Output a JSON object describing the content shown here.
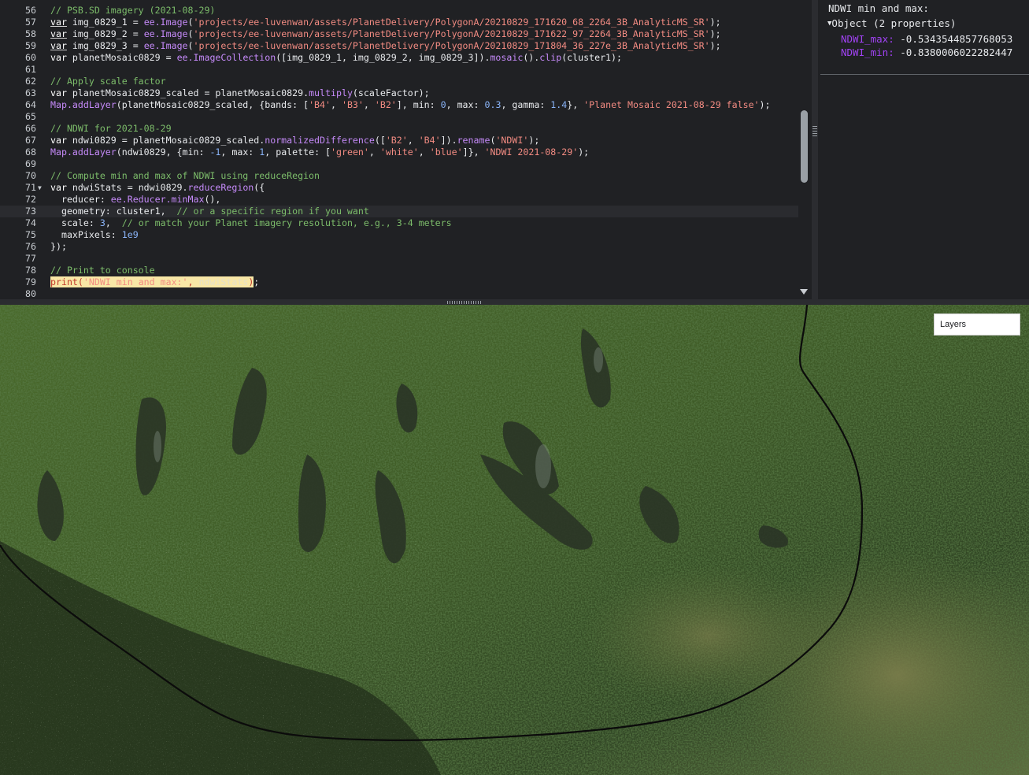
{
  "editor": {
    "lines": [
      {
        "n": "56",
        "html": "<span class=\"cm\">// PSB.SD imagery (2021-08-29)</span>"
      },
      {
        "n": "57",
        "html": "<span class=\"kw\">var</span> img_0829_1 = <span class=\"fn\">ee.Image</span>(<span class=\"str\">'projects/ee-luvenwan/assets/PlanetDelivery/PolygonA/20210829_171620_68_2264_3B_AnalyticMS_SR'</span>);"
      },
      {
        "n": "58",
        "html": "<span class=\"kw\">var</span> img_0829_2 = <span class=\"fn\">ee.Image</span>(<span class=\"str\">'projects/ee-luvenwan/assets/PlanetDelivery/PolygonA/20210829_171622_97_2264_3B_AnalyticMS_SR'</span>);"
      },
      {
        "n": "59",
        "html": "<span class=\"kw\">var</span> img_0829_3 = <span class=\"fn\">ee.Image</span>(<span class=\"str\">'projects/ee-luvenwan/assets/PlanetDelivery/PolygonA/20210829_171804_36_227e_3B_AnalyticMS_SR'</span>);"
      },
      {
        "n": "60",
        "html": "<span class=\"kw2\">var</span> planetMosaic0829 = <span class=\"fn\">ee.ImageCollection</span>([img_0829_1, img_0829_2, img_0829_3]).<span class=\"fn\">mosaic</span>().<span class=\"fn\">clip</span>(cluster1);"
      },
      {
        "n": "61",
        "html": ""
      },
      {
        "n": "62",
        "html": "<span class=\"cm\">// Apply scale factor</span>"
      },
      {
        "n": "63",
        "html": "<span class=\"kw2\">var</span> planetMosaic0829_scaled = planetMosaic0829.<span class=\"fn\">multiply</span>(scaleFactor);"
      },
      {
        "n": "64",
        "html": "<span class=\"fn\">Map.addLayer</span>(planetMosaic0829_scaled, {bands: [<span class=\"str\">'B4'</span>, <span class=\"str\">'B3'</span>, <span class=\"str\">'B2'</span>], min: <span class=\"num\">0</span>, max: <span class=\"num\">0.3</span>, gamma: <span class=\"num\">1.4</span>}, <span class=\"str\">'Planet Mosaic 2021-08-29 false'</span>);"
      },
      {
        "n": "65",
        "html": ""
      },
      {
        "n": "66",
        "html": "<span class=\"cm\">// NDWI for 2021-08-29</span>"
      },
      {
        "n": "67",
        "html": "<span class=\"kw2\">var</span> ndwi0829 = planetMosaic0829_scaled.<span class=\"fn\">normalizedDifference</span>([<span class=\"str\">'B2'</span>, <span class=\"str\">'B4'</span>]).<span class=\"fn\">rename</span>(<span class=\"str\">'NDWI'</span>);"
      },
      {
        "n": "68",
        "html": "<span class=\"fn\">Map.addLayer</span>(ndwi0829, {min: <span class=\"num\">-1</span>, max: <span class=\"num\">1</span>, palette: [<span class=\"str\">'green'</span>, <span class=\"str\">'white'</span>, <span class=\"str\">'blue'</span>]}, <span class=\"str\">'NDWI 2021-08-29'</span>);"
      },
      {
        "n": "69",
        "html": ""
      },
      {
        "n": "70",
        "html": "<span class=\"cm\">// Compute min and max of NDWI using reduceRegion</span>"
      },
      {
        "n": "71",
        "html": "<span class=\"kw2\">var</span> ndwiStats = ndwi0829.<span class=\"fn\">reduceRegion</span>({",
        "fold": true
      },
      {
        "n": "72",
        "html": "  reducer: <span class=\"fn\">ee.Reducer.minMax</span>(),"
      },
      {
        "n": "73",
        "html": "  geometry: cluster1,  <span class=\"cm\">// or a specific region if you want</span>",
        "active": true
      },
      {
        "n": "74",
        "html": "  scale: <span class=\"num\">3</span>,  <span class=\"cm\">// or match your Planet imagery resolution, e.g., 3-4 meters</span>"
      },
      {
        "n": "75",
        "html": "  maxPixels: <span class=\"num\">1e9</span>"
      },
      {
        "n": "76",
        "html": "});"
      },
      {
        "n": "77",
        "html": ""
      },
      {
        "n": "78",
        "html": "<span class=\"cm\">// Print to console</span>"
      },
      {
        "n": "79",
        "html": "<span class=\"hl\">print(<span class=\"str\">'NDWI min and max:'</span>, <span class=\"hl2\">ndwiStats</span>)</span>;"
      },
      {
        "n": "80",
        "html": ""
      }
    ]
  },
  "console": {
    "title": "NDWI min and max:",
    "object_label": "Object (2 properties)",
    "props": [
      {
        "key": "NDWI_max:",
        "value": "-0.5343544857768053"
      },
      {
        "key": "NDWI_min:",
        "value": "-0.8380006022282447"
      }
    ]
  },
  "map": {
    "layers_label": "Layers"
  },
  "colors": {
    "editor_bg": "#202124",
    "keyword": "#ffffff",
    "function": "#c58af9",
    "string": "#f28b82",
    "number": "#8ab4f8",
    "comment": "#7cbc6a",
    "console_key": "#a142f4"
  }
}
